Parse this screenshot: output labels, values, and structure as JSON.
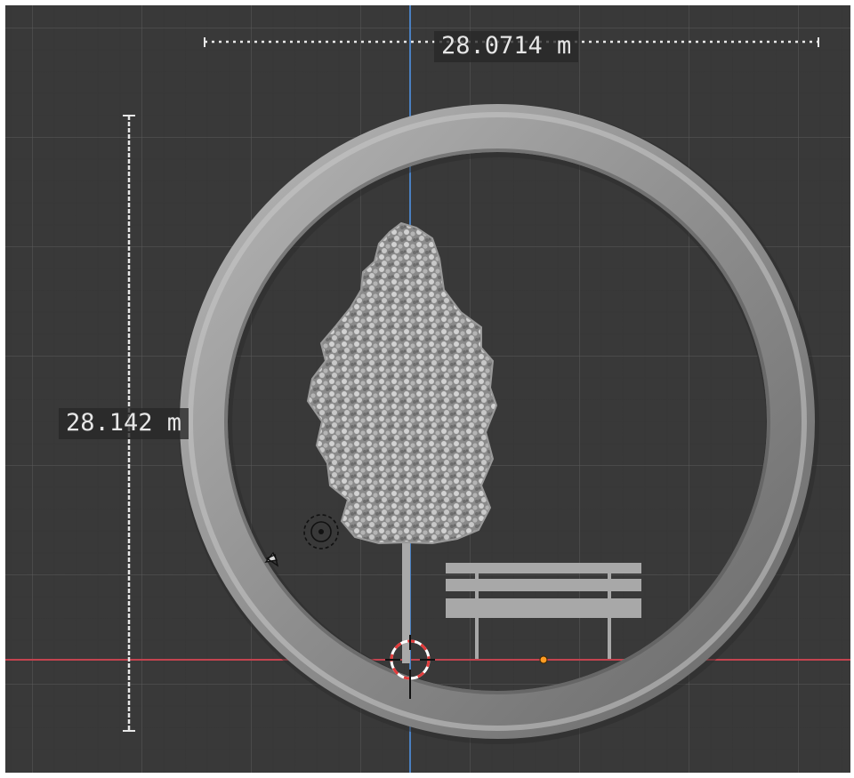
{
  "viewport": {
    "background_color": "#393939",
    "axis_x_color": "#c4434f",
    "axis_y_color": "#4a7fc0"
  },
  "measurements": {
    "width_label": "28.0714 m",
    "height_label": "28.142 m",
    "ruler_color": "#e8e8e8"
  },
  "objects": {
    "ring": {
      "icon": "torus-ring",
      "color": "#8c8c8c"
    },
    "tree": {
      "icon": "tree",
      "color": "#bdbdbd"
    },
    "bench": {
      "icon": "bench",
      "color": "#a8a8a8"
    },
    "light": {
      "icon": "light-icon"
    },
    "camera": {
      "icon": "camera-icon"
    },
    "origin": {
      "icon": "origin-point",
      "color": "#ff9c22"
    },
    "cursor": {
      "icon": "3d-cursor",
      "color": "#ff3f3f"
    }
  }
}
